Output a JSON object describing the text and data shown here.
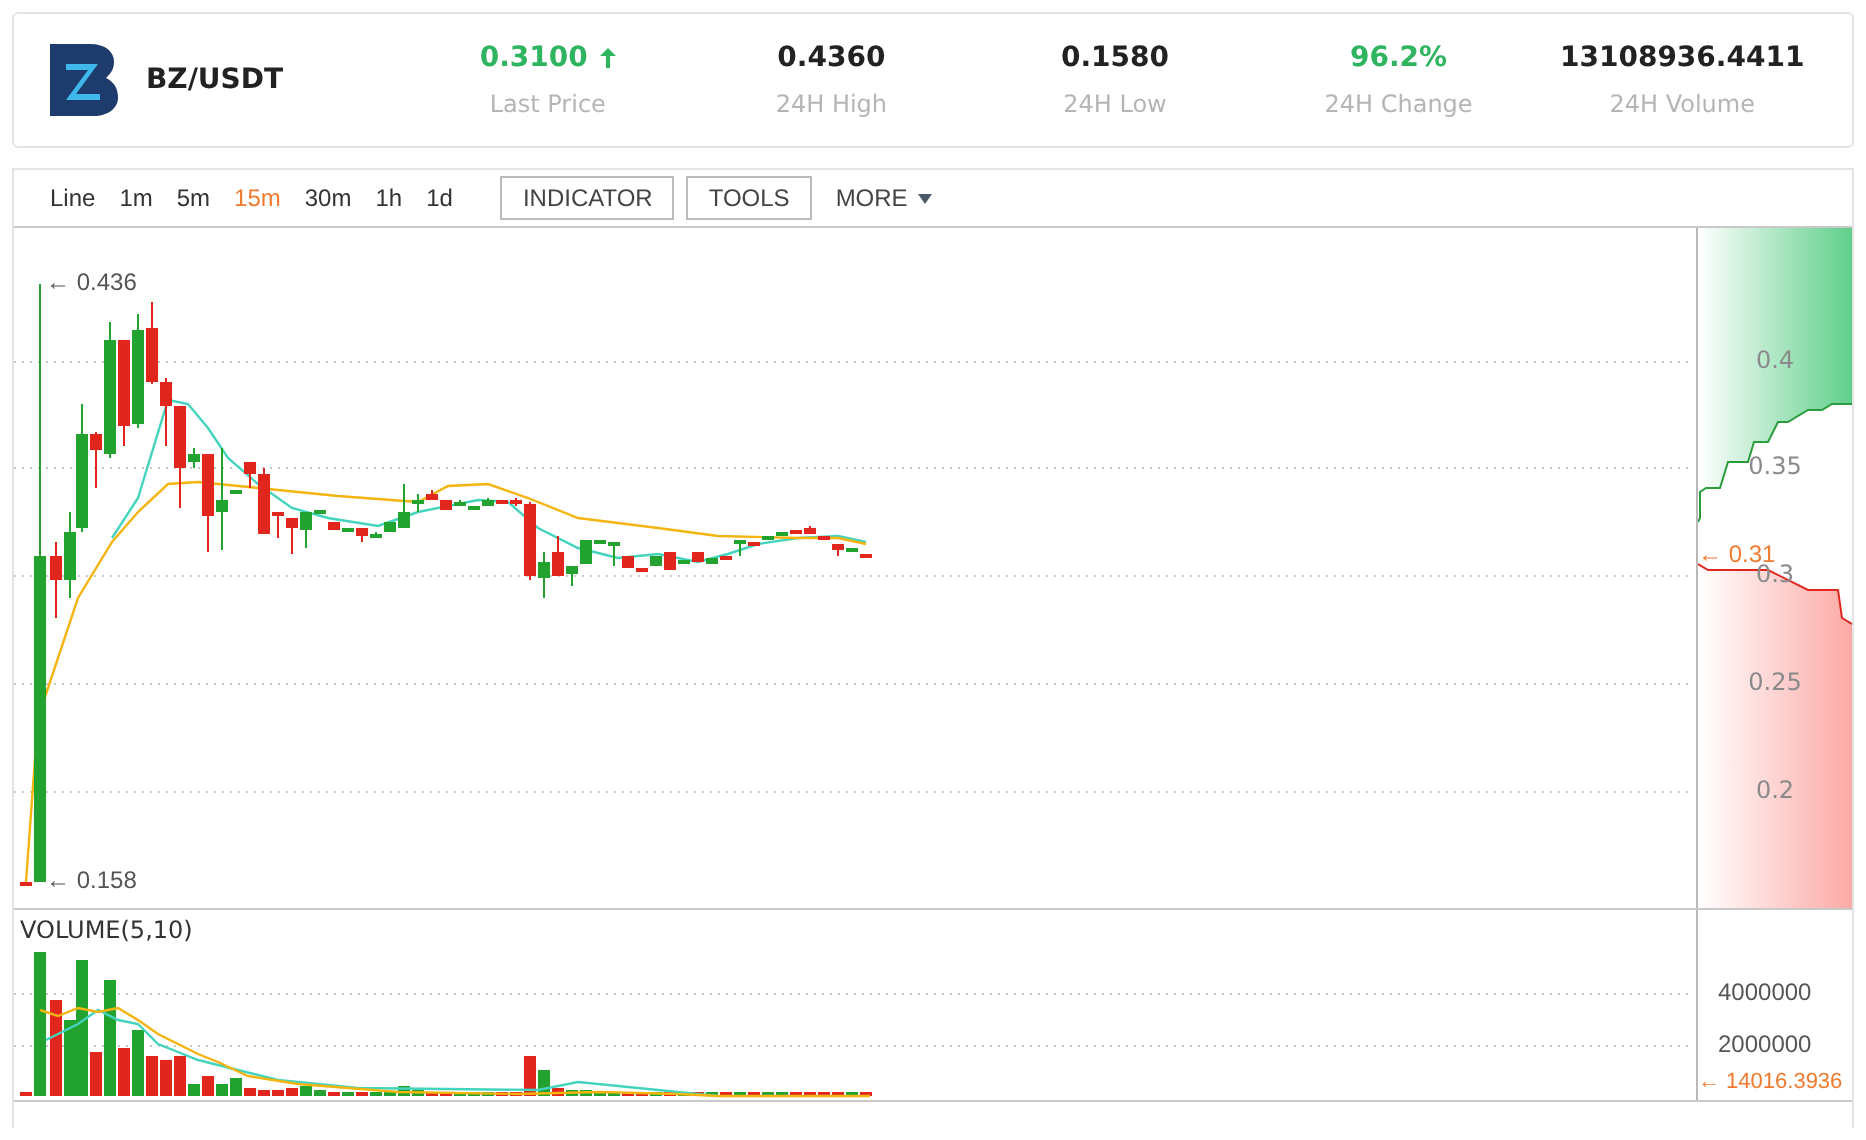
{
  "header": {
    "pair": "BZ/USDT",
    "stats": [
      {
        "value": "0.3100",
        "label": "Last Price",
        "color": "#2fb45f",
        "arrow": true
      },
      {
        "value": "0.4360",
        "label": "24H High",
        "color": "#222222",
        "arrow": false
      },
      {
        "value": "0.1580",
        "label": "24H Low",
        "color": "#222222",
        "arrow": false
      },
      {
        "value": "96.2%",
        "label": "24H Change",
        "color": "#2fb45f",
        "arrow": false
      },
      {
        "value": "13108936.4411",
        "label": "24H Volume",
        "color": "#222222",
        "arrow": false
      }
    ]
  },
  "toolbar": {
    "intervals": [
      {
        "label": "Line",
        "selected": false
      },
      {
        "label": "1m",
        "selected": false
      },
      {
        "label": "5m",
        "selected": false
      },
      {
        "label": "15m",
        "selected": true
      },
      {
        "label": "30m",
        "selected": false
      },
      {
        "label": "1h",
        "selected": false
      },
      {
        "label": "1d",
        "selected": false
      }
    ],
    "buttons": [
      "INDICATOR",
      "TOOLS"
    ],
    "more": "MORE"
  },
  "price_chart": {
    "axis_labels": [
      "0.4",
      "0.35",
      "0.3",
      "0.25",
      "0.2"
    ],
    "high_marker": "← 0.436",
    "low_marker": "← 0.158",
    "current_price": "← 0.31"
  },
  "volume_chart": {
    "title": "VOLUME(5,10)",
    "axis_labels": [
      "4000000",
      "2000000"
    ],
    "last_volume": "← 14016.3936"
  }
}
